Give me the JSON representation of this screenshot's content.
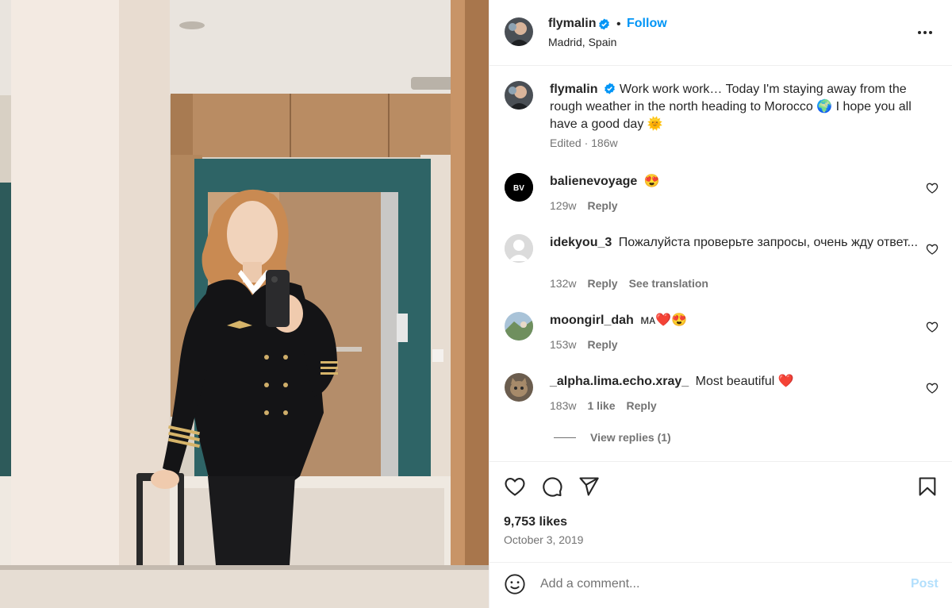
{
  "post": {
    "author": "flymalin",
    "follow_label": "Follow",
    "dot": "•",
    "location": "Madrid, Spain",
    "caption": "Work work work… Today I'm staying away from the rough weather in the north heading to Morocco 🌍 I hope you all have a good day 🌞",
    "caption_meta": "Edited · 186w",
    "likes": "9,753 likes",
    "date": "October 3, 2019"
  },
  "comments": [
    {
      "user": "balienevoyage",
      "text": "😍",
      "age": "129w",
      "reply": "Reply",
      "avatar_text": "BV"
    },
    {
      "user": "idekyou_3",
      "text": "Пожалуйста проверьте запросы, очень жду ответ...",
      "age": "132w",
      "reply": "Reply",
      "translate": "See translation"
    },
    {
      "user": "moongirl_dah",
      "text": "ᴍᴀ❤️😍",
      "age": "153w",
      "reply": "Reply"
    },
    {
      "user": "_alpha.lima.echo.xray_",
      "text": "Most beautiful ❤️",
      "age": "183w",
      "likes": "1 like",
      "reply": "Reply"
    }
  ],
  "view_replies": "View replies (1)",
  "add_comment": {
    "placeholder": "Add a comment...",
    "post_label": "Post"
  },
  "icons": {
    "more": "more-options-icon",
    "verified": "verified-badge-icon",
    "like": "heart-icon",
    "comment": "comment-icon",
    "share": "share-icon",
    "save": "bookmark-icon",
    "emoji": "emoji-icon"
  },
  "colors": {
    "accent": "#0095f6",
    "muted": "#737373",
    "text": "#262626",
    "post_disabled": "#b2dffc"
  }
}
